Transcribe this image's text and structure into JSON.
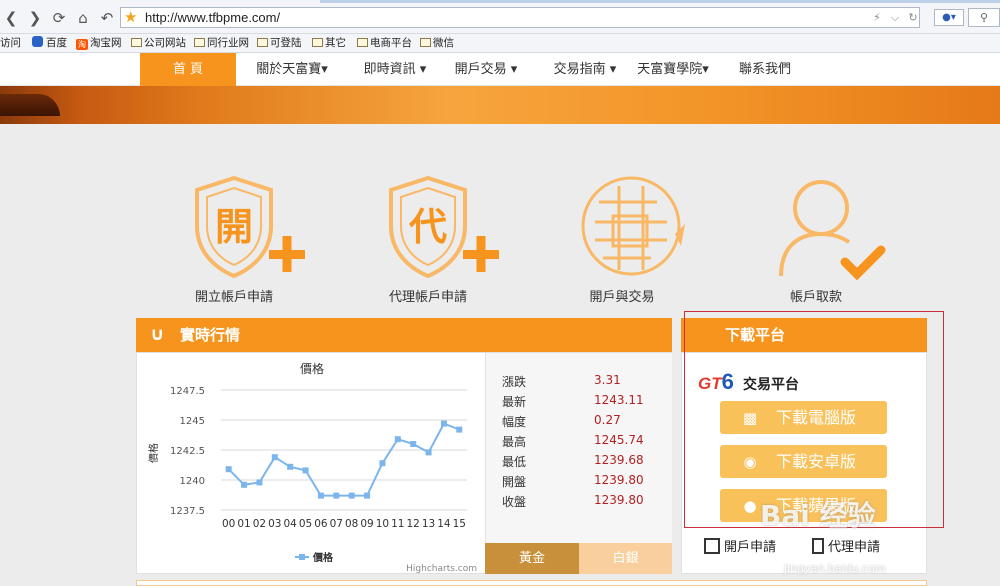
{
  "browser": {
    "url": "http://www.tfbpme.com/",
    "bookmarks": [
      "访问",
      "百度",
      "淘宝网",
      "公司网站",
      "同行业网",
      "可登陆",
      "其它",
      "电商平台",
      "微信"
    ]
  },
  "nav": {
    "items": [
      "首 頁",
      "關於天富寶▾",
      "即時資訊 ▾",
      "開戶交易 ▾",
      "交易指南 ▾",
      "天富寶學院▾",
      "聯系我們"
    ]
  },
  "features": [
    {
      "label": "開立帳戶申請",
      "glyph": "開",
      "icon": "shield-plus-icon"
    },
    {
      "label": "代理帳戶申請",
      "glyph": "代",
      "icon": "shield-plus-icon"
    },
    {
      "label": "開戶與交易",
      "icon": "globe-arrow-icon"
    },
    {
      "label": "帳戶取款",
      "icon": "user-check-icon"
    }
  ],
  "quotes": {
    "title": "實時行情",
    "tabs": [
      "黃金",
      "白銀"
    ],
    "stats": [
      {
        "k": "漲跌",
        "v": "3.31"
      },
      {
        "k": "最新",
        "v": "1243.11"
      },
      {
        "k": "幅度",
        "v": "0.27"
      },
      {
        "k": "最高",
        "v": "1245.74"
      },
      {
        "k": "最低",
        "v": "1239.68"
      },
      {
        "k": "開盤",
        "v": "1239.80"
      },
      {
        "k": "收盤",
        "v": "1239.80"
      }
    ]
  },
  "chart_data": {
    "type": "line",
    "title": "價格",
    "xlabel": "",
    "ylabel": "價格",
    "categories": [
      "00",
      "01",
      "02",
      "03",
      "04",
      "05",
      "06",
      "07",
      "08",
      "09",
      "10",
      "11",
      "12",
      "13",
      "14",
      "15"
    ],
    "series": [
      {
        "name": "價格",
        "values": [
          1240.9,
          1239.6,
          1239.8,
          1241.9,
          1241.1,
          1240.8,
          1238.7,
          1238.7,
          1238.7,
          1238.7,
          1241.4,
          1243.4,
          1243.0,
          1242.3,
          1244.7,
          1244.2
        ]
      }
    ],
    "yticks": [
      1237.5,
      1240,
      1242.5,
      1245,
      1247.5
    ],
    "ytick_labels": [
      "1237.5",
      "1240",
      "1242.5",
      "1245",
      "1247.5"
    ],
    "ylim": [
      1237.5,
      1247.5
    ],
    "grid": true,
    "legend": "bottom-center",
    "credit": "Highcharts.com",
    "color": "#7cb5ec"
  },
  "download": {
    "title": "下載平台",
    "brand_gt": "GT",
    "brand_6": "6",
    "brand_text": "交易平台",
    "buttons": [
      "下載電腦版",
      "下載安卓版",
      "下載蘋果版"
    ],
    "links": [
      "開戶申請",
      "代理申請"
    ]
  },
  "watermark": {
    "main": "Bai 经验",
    "sub": "jingyan.baidu.com"
  },
  "colors": {
    "accent": "#f7941d",
    "icon": "#f7941d",
    "tab_gold": "#c8903a",
    "tab_silver": "#f9cf9d"
  }
}
